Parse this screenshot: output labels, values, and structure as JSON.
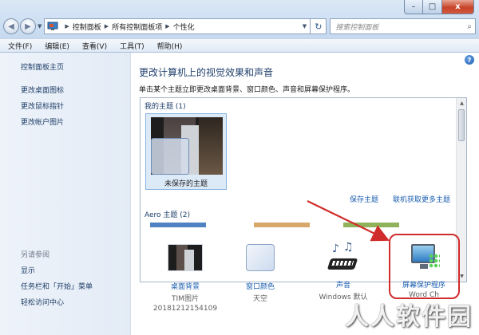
{
  "window": {
    "controls": {
      "minimize": "–",
      "maximize": "□",
      "close": "x"
    }
  },
  "nav": {
    "back_icon": "back-arrow-icon",
    "forward_icon": "forward-arrow-icon",
    "breadcrumb": [
      "控制面板",
      "所有控制面板项",
      "个性化"
    ],
    "search_placeholder": "搜索控制面板"
  },
  "menu": [
    "文件(F)",
    "编辑(E)",
    "查看(V)",
    "工具(T)",
    "帮助(H)"
  ],
  "sidebar": {
    "home": "控制面板主页",
    "links": [
      "更改桌面图标",
      "更改鼠标指针",
      "更改帐户图片"
    ],
    "see_also_title": "另请参阅",
    "see_also": [
      "显示",
      "任务栏和「开始」菜单",
      "轻松访问中心"
    ]
  },
  "main": {
    "title": "更改计算机上的视觉效果和声音",
    "description": "单击某个主题立即更改桌面背景、窗口颜色、声音和屏幕保护程序。",
    "groups": {
      "my_themes": "我的主题 (1)",
      "aero_themes": "Aero 主题 (2)"
    },
    "theme": {
      "name": "未保存的主题"
    },
    "theme_links": {
      "save": "保存主题",
      "online": "联机获取更多主题"
    },
    "settings": [
      {
        "label": "桌面背景",
        "sub1": "TIM图片",
        "sub2": "20181212154109"
      },
      {
        "label": "窗口颜色",
        "sub1": "天空"
      },
      {
        "label": "声音",
        "sub1": "Windows 默认"
      },
      {
        "label": "屏幕保护程序",
        "sub1": "Word Ch"
      }
    ]
  },
  "overlay": {
    "watermark": "人人软件园",
    "highlight_color": "#d12c2c"
  }
}
